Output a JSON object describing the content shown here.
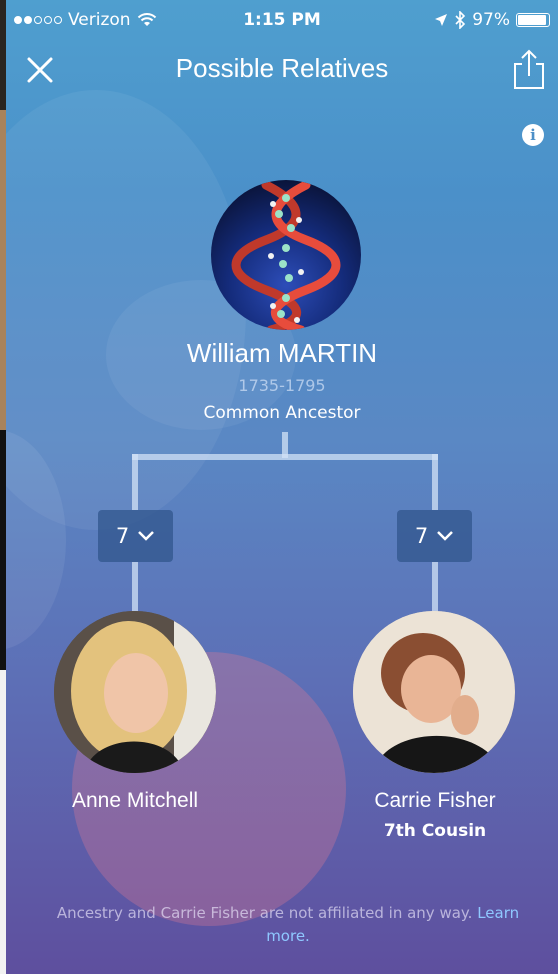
{
  "status_bar": {
    "carrier": "Verizon",
    "time": "1:15 PM",
    "battery": "97%",
    "battery_level": 0.97
  },
  "nav": {
    "title": "Possible Relatives",
    "close_icon": "close-icon",
    "share_icon": "share-icon",
    "info_icon": "info-icon"
  },
  "ancestor": {
    "name": "William MARTIN",
    "years": "1735-1795",
    "role": "Common Ancestor"
  },
  "generations": {
    "left": "7",
    "right": "7"
  },
  "relatives": {
    "left_name": "Anne Mitchell",
    "right_name": "Carrie Fisher",
    "relationship": "7th Cousin"
  },
  "footer": {
    "disclaimer": "Ancestry and Carrie Fisher are not affiliated in any way.",
    "learn_more": "Learn more."
  },
  "colors": {
    "background_top": "#4f9fcf",
    "background_bottom": "#5e4f9e",
    "link": "#8fc8ff"
  }
}
